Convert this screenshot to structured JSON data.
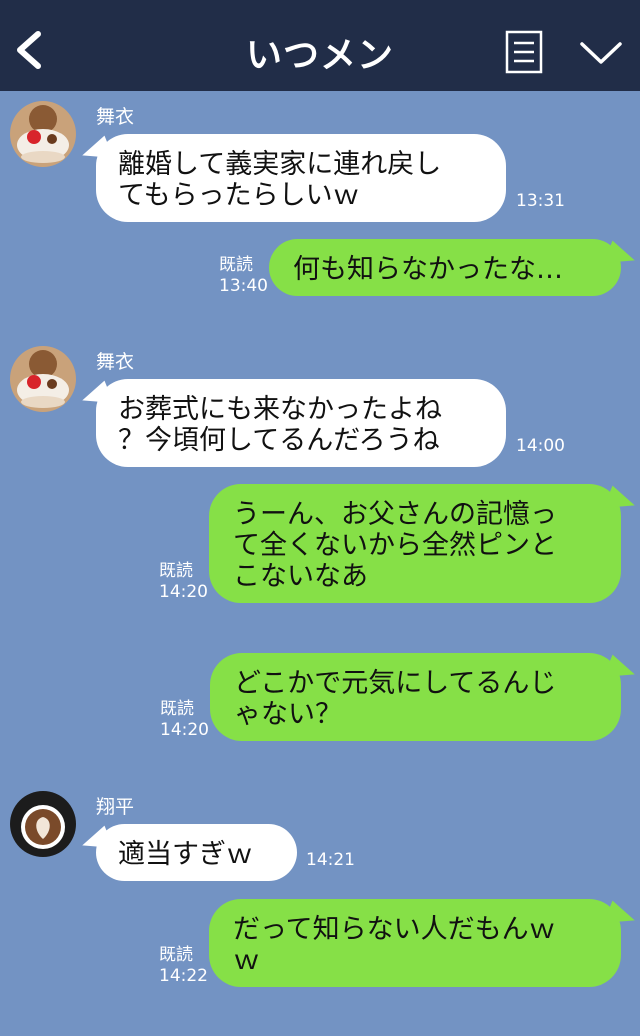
{
  "header": {
    "title": "いつメン"
  },
  "colors": {
    "header_bg": "#212d48",
    "chat_bg": "#7393c3",
    "incoming_bubble": "#ffffff",
    "outgoing_bubble": "#86e047"
  },
  "icons": {
    "back": "back-chevron-icon",
    "menu": "notes-menu-icon",
    "expand": "chevron-down-icon"
  },
  "messages": [
    {
      "type": "incoming",
      "sender": "舞衣",
      "text": "離婚して義実家に連れ戻し\nてもらったらしいｗ",
      "time": "13:31"
    },
    {
      "type": "outgoing",
      "read_label": "既読",
      "text": "何も知らなかったな…",
      "time": "13:40"
    },
    {
      "type": "incoming",
      "sender": "舞衣",
      "text": "お葬式にも来なかったよね\n？今頃何してるんだろうね",
      "time": "14:00"
    },
    {
      "type": "outgoing",
      "read_label": "既読",
      "text": "うーん、お父さんの記憶っ\nて全くないから全然ピンと\nこないなあ",
      "time": "14:20"
    },
    {
      "type": "outgoing",
      "read_label": "既読",
      "text": "どこかで元気にしてるんじ\nゃない？",
      "time": "14:20"
    },
    {
      "type": "incoming",
      "sender": "翔平",
      "text": "適当すぎｗ",
      "time": "14:21"
    },
    {
      "type": "outgoing",
      "read_label": "既読",
      "text": "だって知らない人だもんｗ\nｗ",
      "time": "14:22"
    }
  ]
}
